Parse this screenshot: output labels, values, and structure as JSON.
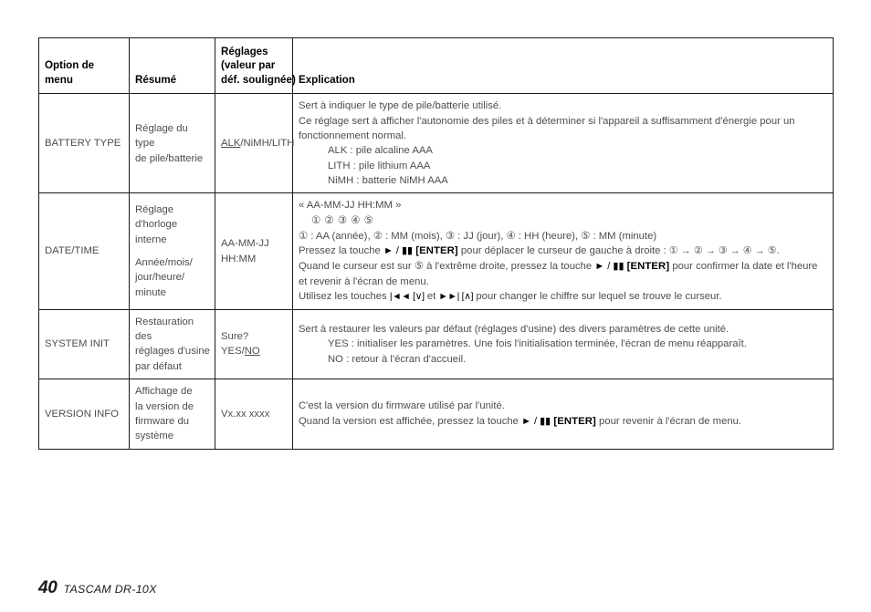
{
  "document": {
    "footer": {
      "page_number": "40",
      "brand_model": "TASCAM  DR-10X"
    }
  },
  "table": {
    "headers": {
      "option": "Option de menu",
      "summary": "Résumé",
      "setting_l1": "Réglages",
      "setting_l2": "(valeur par",
      "setting_l3": "déf. soulignée)",
      "explanation": "Explication"
    },
    "rows": [
      {
        "option": "BATTERY TYPE",
        "summary_l1": "Réglage du type",
        "summary_l2": "de pile/batterie",
        "setting_default": "ALK",
        "setting_rest": "/NiMH/LITH",
        "explanation": {
          "l1": "Sert à indiquer le type de pile/batterie utilisé.",
          "l2": "Ce réglage sert à afficher l'autonomie des piles et à déterminer si l'appareil a suffisamment d'énergie pour un fonctionnement normal.",
          "l3": "ALK : pile alcaline AAA",
          "l4": "LITH : pile lithium AAA",
          "l5": "NiMH : batterie NiMH AAA"
        }
      },
      {
        "option": "DATE/TIME",
        "summary_l1": "Réglage",
        "summary_l2": "d'horloge",
        "summary_l3": "interne",
        "summary_l4": "Année/mois/",
        "summary_l5": "jour/heure/",
        "summary_l6": "minute",
        "setting_l1": "AA-MM-JJ",
        "setting_l2": "HH:MM",
        "explanation": {
          "format": "« AA-MM-JJ HH:MM »",
          "markers": "① ② ③ ④ ⑤",
          "legend": "① : AA (année), ② : MM (mois), ③ : JJ (jour), ④ : HH (heure), ⑤ : MM (minute)",
          "enter_line_a": "Pressez la touche ",
          "enter_glyph": "► / ▮▮",
          "enter_label": "[ENTER]",
          "enter_line_b": " pour déplacer le curseur de gauche à droite : ",
          "enter_sequence": "① → ② → ③ → ④ → ⑤.",
          "confirm_a": "Quand le curseur est sur ⑤ à l'extrême droite, pressez la touche ",
          "confirm_b": " pour confirmer la date et l'heure et revenir à l'écran de menu.",
          "change_a": "Utilisez les touches ",
          "change_glyph_back": "|◄◄ [∨]",
          "change_mid": " et ",
          "change_glyph_fwd": "►►| [∧]",
          "change_b": " pour changer le chiffre sur lequel se trouve le curseur."
        }
      },
      {
        "option": "SYSTEM INIT",
        "summary_l1": "Restauration des",
        "summary_l2": "réglages d'usine",
        "summary_l3": "par défaut",
        "setting_pre": "Sure? YES/",
        "setting_default": "NO",
        "explanation": {
          "l1": "Sert à restaurer les valeurs par défaut (réglages d'usine) des divers paramètres de cette unité.",
          "l2": "YES : initialiser les paramètres. Une fois l'initialisation terminée, l'écran de menu réapparaît.",
          "l3": "NO : retour à l'écran d'accueil."
        }
      },
      {
        "option": "VERSION INFO",
        "summary_l1": "Affichage de",
        "summary_l2": "la version de",
        "summary_l3": "firmware du",
        "summary_l4": "système",
        "setting": "Vx.xx xxxx",
        "explanation": {
          "l1": "C'est la version du firmware utilisé par l'unité.",
          "l2_a": "Quand la version est affichée, pressez la touche ",
          "l2_glyph": "► / ▮▮",
          "l2_label": "[ENTER]",
          "l2_b": " pour revenir à l'écran de menu."
        }
      }
    ]
  }
}
